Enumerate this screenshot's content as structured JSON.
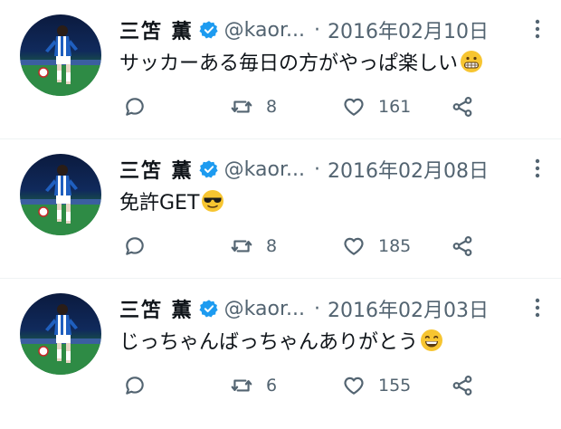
{
  "tweets": [
    {
      "name": "三笘 薫",
      "handle": "@kaor...",
      "separator": "·",
      "date": "2016年02月10日",
      "text": "サッカーある毎日の方がやっぱ楽しい",
      "emoji": "grimacing-face",
      "retweets": "8",
      "likes": "161"
    },
    {
      "name": "三笘 薫",
      "handle": "@kaor...",
      "separator": "·",
      "date": "2016年02月08日",
      "text": "免許GET",
      "emoji": "smiling-face-with-sunglasses",
      "retweets": "8",
      "likes": "185"
    },
    {
      "name": "三笘 薫",
      "handle": "@kaor...",
      "separator": "·",
      "date": "2016年02月03日",
      "text": "じっちゃんばっちゃんありがとう",
      "emoji": "grinning-face-with-smiling-eyes",
      "retweets": "6",
      "likes": "155"
    }
  ],
  "colors": {
    "text": "#0f1419",
    "secondary": "#536471",
    "verified": "#1d9bf0",
    "divider": "#eff3f4"
  }
}
